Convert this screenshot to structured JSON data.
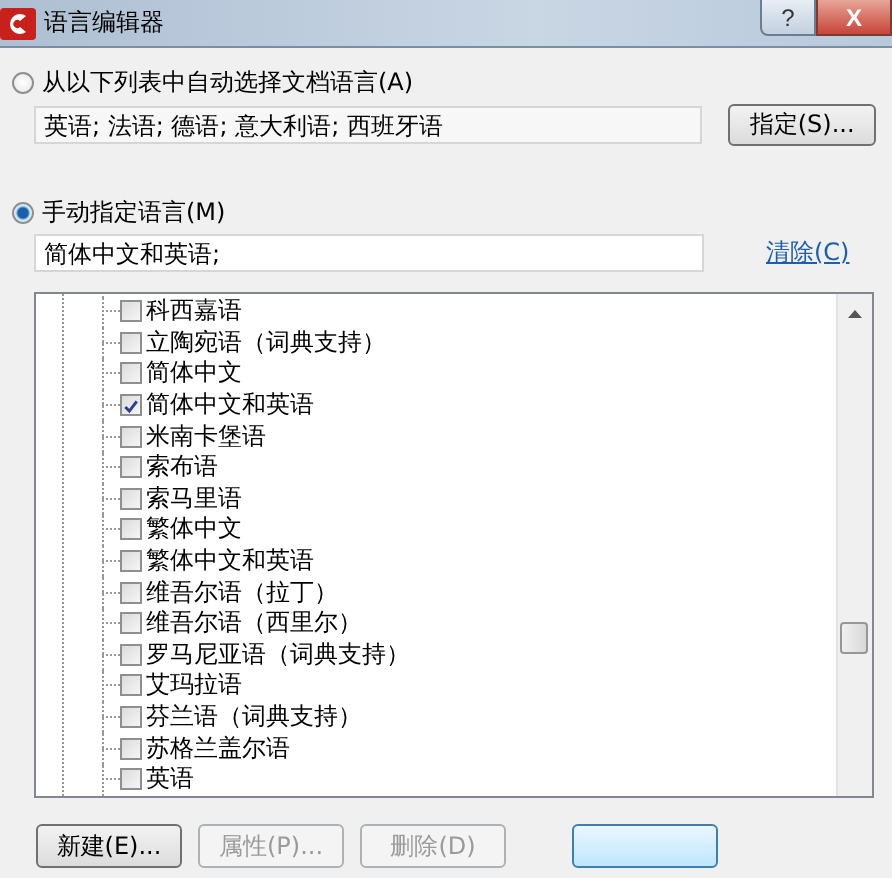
{
  "window": {
    "title": "语言编辑器",
    "help_button": "?",
    "close_button": "X"
  },
  "auto_option": {
    "label": "从以下列表中自动选择文档语言(A)",
    "selected": false,
    "value": "英语; 法语; 德语; 意大利语; 西班牙语",
    "button": "指定(S)..."
  },
  "manual_option": {
    "label": "手动指定语言(M)",
    "selected": true,
    "value": "简体中文和英语;",
    "link": "清除(C)"
  },
  "language_tree": [
    {
      "label": "科西嘉语",
      "checked": false
    },
    {
      "label": "立陶宛语（词典支持）",
      "checked": false
    },
    {
      "label": "简体中文",
      "checked": false
    },
    {
      "label": "简体中文和英语",
      "checked": true
    },
    {
      "label": "米南卡堡语",
      "checked": false
    },
    {
      "label": "索布语",
      "checked": false
    },
    {
      "label": "索马里语",
      "checked": false
    },
    {
      "label": "繁体中文",
      "checked": false
    },
    {
      "label": "繁体中文和英语",
      "checked": false
    },
    {
      "label": "维吾尔语（拉丁）",
      "checked": false
    },
    {
      "label": "维吾尔语（西里尔）",
      "checked": false
    },
    {
      "label": "罗马尼亚语（词典支持）",
      "checked": false
    },
    {
      "label": "艾玛拉语",
      "checked": false
    },
    {
      "label": "芬兰语（词典支持）",
      "checked": false
    },
    {
      "label": "苏格兰盖尔语",
      "checked": false
    },
    {
      "label": "英语",
      "checked": false
    }
  ],
  "buttons": [
    {
      "label": "新建(E)...",
      "disabled": false
    },
    {
      "label": "属性(P)...",
      "disabled": true
    },
    {
      "label": "删除(D)",
      "disabled": true
    }
  ]
}
